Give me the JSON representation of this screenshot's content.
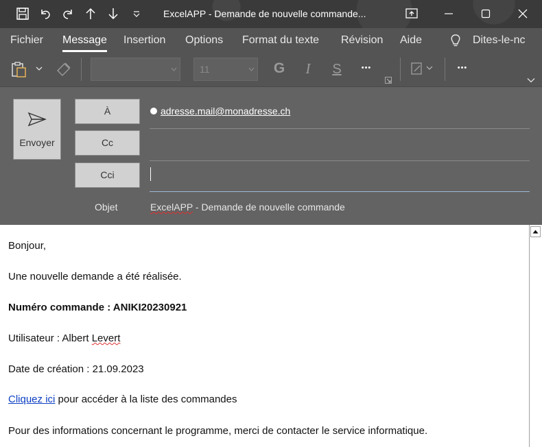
{
  "window": {
    "title": "ExcelAPP - Demande de nouvelle commande...",
    "icons": [
      "save-icon",
      "undo-icon",
      "redo-icon",
      "arrow-up-icon",
      "arrow-down-icon",
      "customize-icon",
      "restore-window-icon",
      "minimize-icon",
      "maximize-icon",
      "close-icon"
    ]
  },
  "menu": {
    "items": [
      "Fichier",
      "Message",
      "Insertion",
      "Options",
      "Format du texte",
      "Révision",
      "Aide"
    ],
    "active": "Message",
    "tell_me": "Dites-le-nc"
  },
  "ribbon": {
    "font_name": "",
    "font_size": "11",
    "bold": "G",
    "italic": "I",
    "underline": "S",
    "more1": "•••",
    "more2": "•••"
  },
  "compose": {
    "send_label": "Envoyer",
    "to_label": "À",
    "cc_label": "Cc",
    "bcc_label": "Cci",
    "to_recipient": "adresse.mail@monadresse.ch",
    "subject_label": "Objet",
    "subject_prefix": "ExcelAPP",
    "subject_rest": " - Demande de nouvelle commande"
  },
  "body": {
    "greeting": "Bonjour,",
    "line1": "Une nouvelle demande a été réalisée.",
    "order_line": "Numéro commande : ANIKI20230921",
    "user_prefix": "Utilisateur : Albert ",
    "user_last": "Levert",
    "date_line": "Date de création : 21.09.2023",
    "link_text": "Cliquez ici",
    "link_rest": " pour accéder à la liste des commandes",
    "info_line": "Pour des informations concernant le programme, merci de contacter le service informatique."
  }
}
